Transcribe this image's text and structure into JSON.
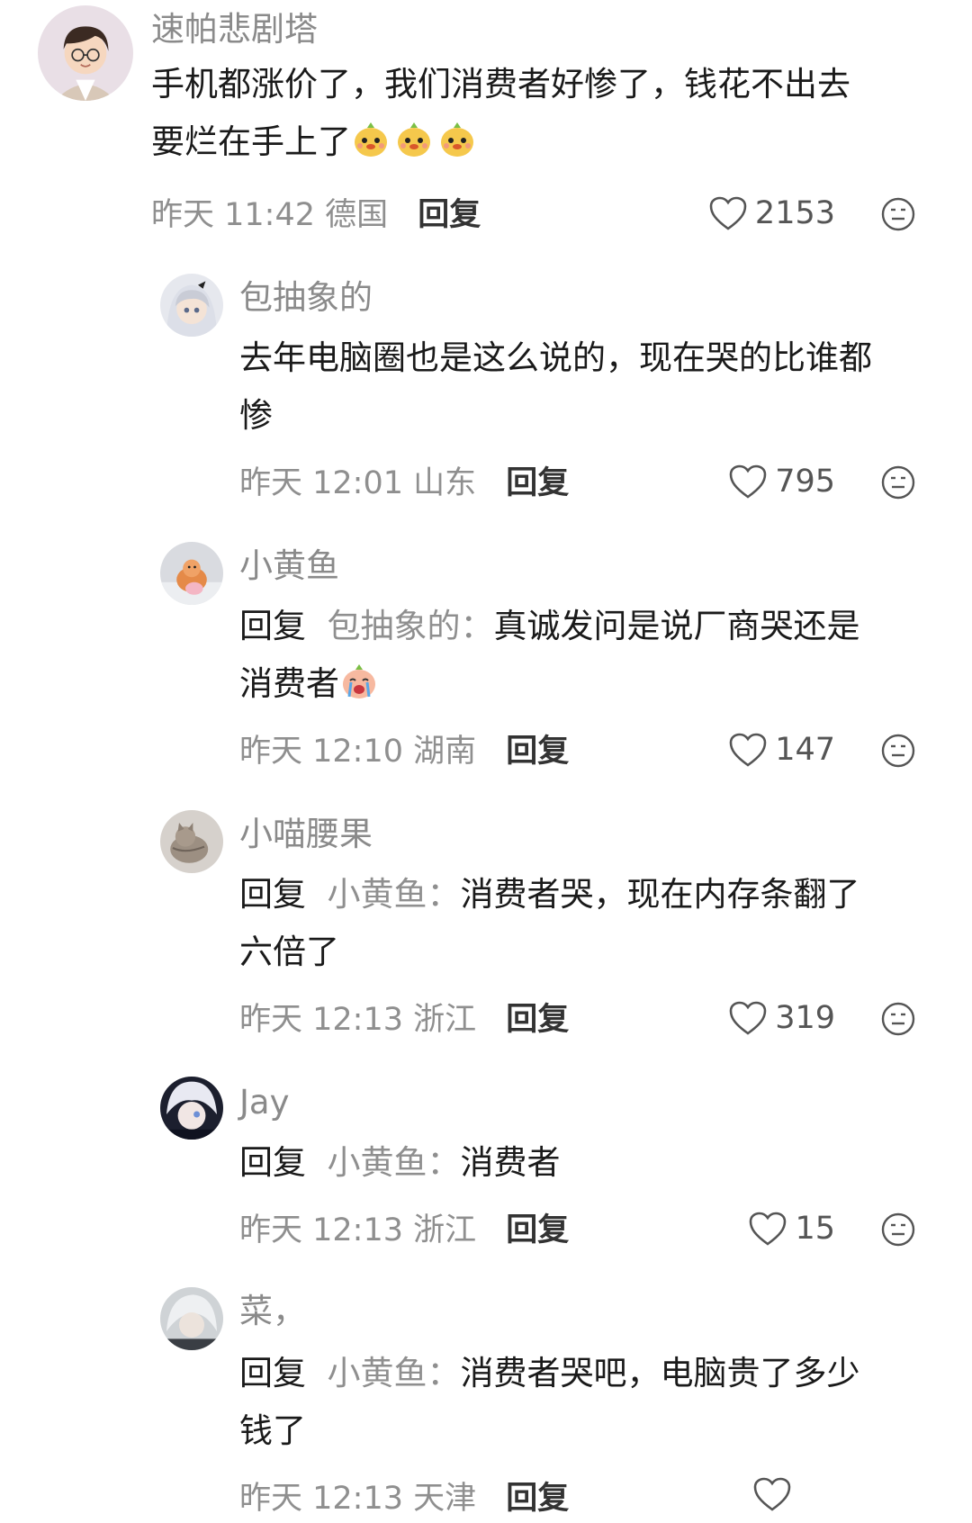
{
  "comments": [
    {
      "username": "速帕悲剧塔",
      "text_line1": "手机都涨价了，我们消费者好惨了，钱花不出去",
      "text_line2": "要烂在手上了",
      "emojis": [
        "fruit-face-emoji",
        "fruit-face-emoji",
        "fruit-face-emoji"
      ],
      "time": "昨天 11:42",
      "location": "德国",
      "reply_label": "回复",
      "likes": "2153"
    },
    {
      "username": "包抽象的",
      "text_line1": "去年电脑圈也是这么说的，现在哭的比谁都",
      "text_line2": "惨",
      "time": "昨天 12:01",
      "location": "山东",
      "reply_label": "回复",
      "likes": "795"
    },
    {
      "username": "小黄鱼",
      "reply_word": "回复",
      "reply_target": "包抽象的：",
      "text_line1": "真诚发问是说厂商哭还是",
      "text_line2": "消费者",
      "emojis": [
        "crying-face-emoji"
      ],
      "time": "昨天 12:10",
      "location": "湖南",
      "reply_label": "回复",
      "likes": "147"
    },
    {
      "username": "小喵腰果",
      "reply_word": "回复",
      "reply_target": "小黄鱼：",
      "text_line1": "消费者哭，现在内存条翻了",
      "text_line2": "六倍了",
      "time": "昨天 12:13",
      "location": "浙江",
      "reply_label": "回复",
      "likes": "319"
    },
    {
      "username": "Jay",
      "reply_word": "回复",
      "reply_target": "小黄鱼：",
      "text_line1": "消费者",
      "time": "昨天 12:13",
      "location": "浙江",
      "reply_label": "回复",
      "likes": "15"
    },
    {
      "username": "菜，",
      "reply_word": "回复",
      "reply_target": "小黄鱼：",
      "text_line1": "消费者哭吧，电脑贵了多少",
      "text_line2": "钱了",
      "time": "昨天 12:13",
      "location": "天津",
      "reply_label": "回复",
      "likes": ""
    }
  ],
  "icons": {
    "like": "heart-outline-icon",
    "dislike": "neutral-face-icon"
  }
}
